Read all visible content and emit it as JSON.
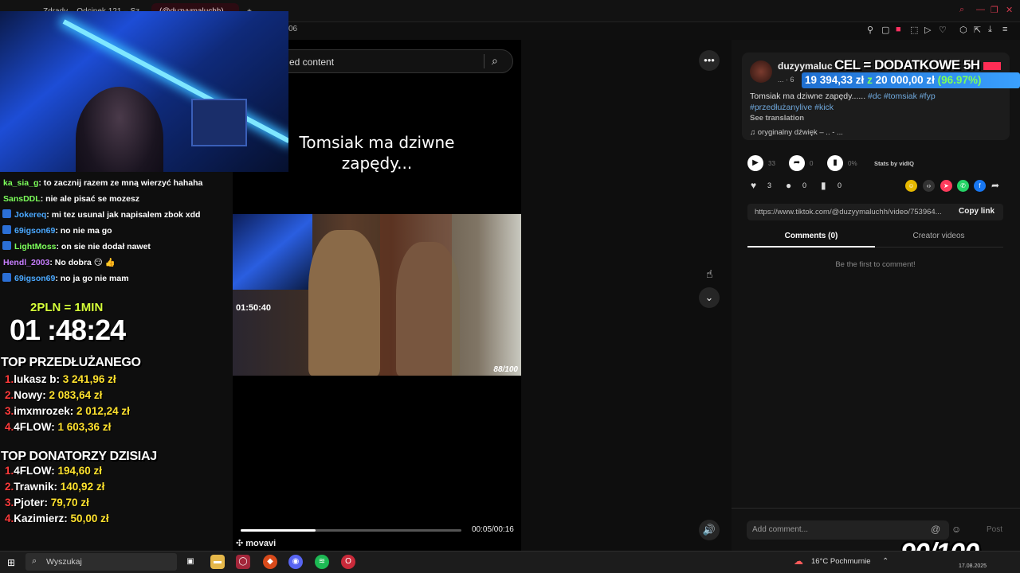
{
  "browser": {
    "tabs": [
      {
        "label": "Zdrady – Odcinek 121 – Sz"
      },
      {
        "label": "(@duzyymaluchh)"
      }
    ],
    "new_tab": "+",
    "toolbar_hint": "06"
  },
  "video": {
    "search_placeholder": "ed content",
    "caption": "Tomsiak ma dziwne\nzapędy...",
    "clip_score": "88/100",
    "clip_timer": "01:50:40",
    "progress_fraction": 0.34,
    "time": "00:05/00:16",
    "watermark": "movavi"
  },
  "author": {
    "name": "duzyymaluc",
    "sub": "... · 6",
    "description_text": "Tomsiak ma dziwne zapędy...... ",
    "hashtags_1": "#dc #tomsiak #fyp",
    "hashtags_2": "#przedłużanylive #kick",
    "see_translation": "See translation",
    "music": "♫  oryginalny dźwięk – .. - ..."
  },
  "stats": {
    "play_count": "33",
    "share_count": "0",
    "chart_pct": "0%",
    "stats_by": "Stats by vidIQ",
    "likes": "3",
    "comments": "0",
    "saves": "0"
  },
  "link": {
    "url": "https://www.tiktok.com/@duzyymaluchh/video/753964...",
    "copy_label": "Copy link"
  },
  "comments": {
    "tab_comments": "Comments (0)",
    "tab_creator": "Creator videos",
    "empty": "Be the first to comment!",
    "input_placeholder": "Add comment...",
    "post_label": "Post"
  },
  "goal": {
    "title": "CEL = DODATKOWE 5H",
    "current": "19 394,33 zł",
    "separator": "z",
    "target": "20 000,00 zł",
    "percent": "(96.97%)"
  },
  "chat": [
    {
      "user": "ka_sia_g",
      "user_color": "#7cff5a",
      "message": ": to zacznij razem ze mną wierzyć hahaha",
      "badge": false
    },
    {
      "user": "SansDDL",
      "user_color": "#7cff5a",
      "message": ": nie ale pisać se mozesz",
      "badge": false
    },
    {
      "user": "Jokereq",
      "user_color": "#4aa8ff",
      "message": ": mi tez usunal jak napisalem zbok xdd",
      "badge": true
    },
    {
      "user": "69igson69",
      "user_color": "#4aa8ff",
      "message": ": no nie ma go",
      "badge": true
    },
    {
      "user": "LightMoss",
      "user_color": "#7cff5a",
      "message": ": on sie nie dodał nawet",
      "badge": true
    },
    {
      "user": "Hendl_2003",
      "user_color": "#c77dff",
      "message": ": No dobra 😏 👍",
      "badge": false
    },
    {
      "user": "69igson69",
      "user_color": "#4aa8ff",
      "message": ": no ja go nie mam",
      "badge": true
    }
  ],
  "overlay": {
    "rate": "2PLN = 1MIN",
    "timer": "01 :48:24",
    "top_extended_title": "TOP PRZEDŁUŻANEGO",
    "top_extended": [
      {
        "rank": "1.",
        "name": "lukasz b:",
        "amount": "3 241,96 zł"
      },
      {
        "rank": "2.",
        "name": "Nowy:",
        "amount": "2 083,64 zł"
      },
      {
        "rank": "3.",
        "name": "imxmrozek:",
        "amount": "2 012,24 zł"
      },
      {
        "rank": "4.",
        "name": "4FLOW:",
        "amount": "1 603,36 zł"
      }
    ],
    "top_today_title": "TOP DONATORZY DZISIAJ",
    "top_today": [
      {
        "rank": "1.",
        "name": "4FLOW:",
        "amount": "194,60 zł"
      },
      {
        "rank": "2.",
        "name": "Trawnik:",
        "amount": "140,92 zł"
      },
      {
        "rank": "3.",
        "name": "Pjoter:",
        "amount": "79,70 zł"
      },
      {
        "rank": "4.",
        "name": "Kazimierz:",
        "amount": "50,00 zł"
      }
    ],
    "score": "90/100"
  },
  "taskbar": {
    "search_placeholder": "Wyszukaj",
    "weather": "16°C  Pochmurnie",
    "date": "17.08.2025"
  },
  "icons": {
    "more": "more-horizontal-icon",
    "down": "chevron-down-icon",
    "volume": "volume-icon",
    "search": "search-icon"
  }
}
